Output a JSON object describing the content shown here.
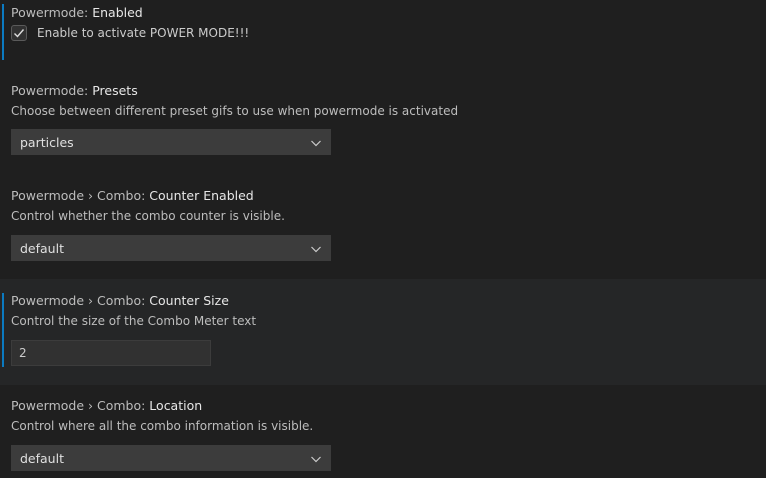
{
  "settings": [
    {
      "category": "Powermode: ",
      "key": "Enabled",
      "checkbox_label": "Enable to activate POWER MODE!!!",
      "checked": true
    },
    {
      "category": "Powermode: ",
      "key": "Presets",
      "description": "Choose between different preset gifs to use when powermode is activated",
      "value": "particles"
    },
    {
      "category": "Powermode › Combo: ",
      "key": "Counter Enabled",
      "description": "Control whether the combo counter is visible.",
      "value": "default"
    },
    {
      "category": "Powermode › Combo: ",
      "key": "Counter Size",
      "description": "Control the size of the Combo Meter text",
      "value": "2"
    },
    {
      "category": "Powermode › Combo: ",
      "key": "Location",
      "description": "Control where all the combo information is visible.",
      "value": "default"
    }
  ],
  "colors": {
    "background": "#1f1f1f",
    "modified_indicator": "#0b7ac1",
    "dropdown_bg": "#3c3c3c"
  },
  "icons": {
    "check": "check-icon",
    "chevron": "chevron-down-icon"
  }
}
